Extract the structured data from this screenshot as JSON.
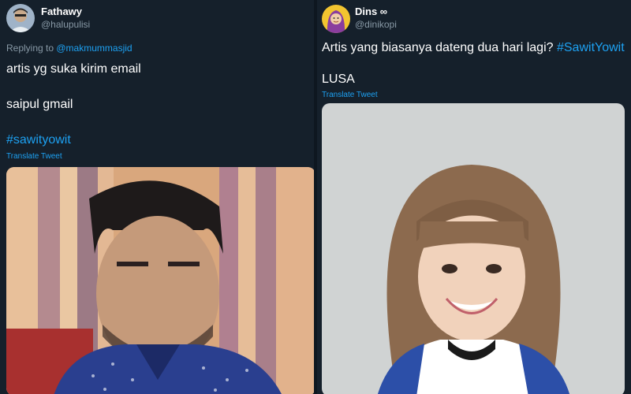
{
  "left_tweet": {
    "display_name": "Fathawy",
    "handle": "@halupulisi",
    "replying_prefix": "Replying to ",
    "replying_mention": "@makmummasjid",
    "lines": [
      "artis yg suka kirim email",
      "saipul gmail"
    ],
    "hashtag": "#sawityowit",
    "translate_label": "Translate Tweet"
  },
  "right_tweet": {
    "display_name": "Dins ∞",
    "handle": "@dinikopi",
    "text": "Artis yang biasanya dateng dua hari lagi? ",
    "hashtag": "#SawitYowit",
    "line2": "LUSA",
    "translate_label": "Translate Tweet"
  },
  "colors": {
    "background": "#15202b",
    "link": "#1da1f2",
    "secondary_text": "#8899a6"
  }
}
